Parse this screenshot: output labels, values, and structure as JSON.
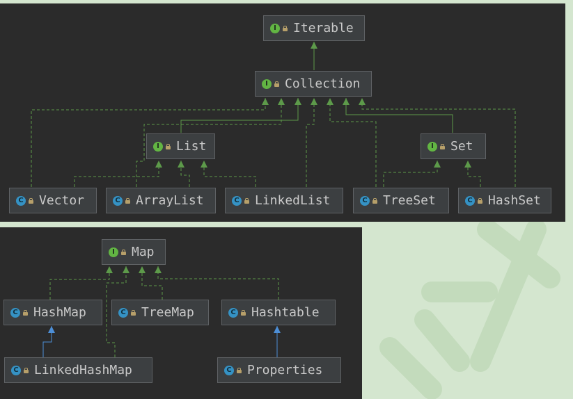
{
  "colors": {
    "panel_bg": "#2b2b2b",
    "node_bg": "#3c3f41",
    "interface_badge": "#62b543",
    "class_badge": "#3592c4",
    "implements_edge": "#5d9a4a",
    "extends_edge": "#4d8fd7"
  },
  "collection_diagram": {
    "nodes": {
      "iterable": {
        "label": "Iterable",
        "kind": "interface",
        "badge": "I"
      },
      "collection": {
        "label": "Collection",
        "kind": "interface",
        "badge": "I"
      },
      "list": {
        "label": "List",
        "kind": "interface",
        "badge": "I"
      },
      "set": {
        "label": "Set",
        "kind": "interface",
        "badge": "I"
      },
      "vector": {
        "label": "Vector",
        "kind": "class",
        "badge": "C"
      },
      "arraylist": {
        "label": "ArrayList",
        "kind": "class",
        "badge": "C"
      },
      "linkedlist": {
        "label": "LinkedList",
        "kind": "class",
        "badge": "C"
      },
      "treeset": {
        "label": "TreeSet",
        "kind": "class",
        "badge": "C"
      },
      "hashset": {
        "label": "HashSet",
        "kind": "class",
        "badge": "C"
      }
    },
    "edges": [
      {
        "from": "Collection",
        "to": "Iterable",
        "type": "extends-interface"
      },
      {
        "from": "List",
        "to": "Collection",
        "type": "extends-interface"
      },
      {
        "from": "Set",
        "to": "Collection",
        "type": "extends-interface"
      },
      {
        "from": "Vector",
        "to": "Collection",
        "type": "implements"
      },
      {
        "from": "Vector",
        "to": "List",
        "type": "implements"
      },
      {
        "from": "ArrayList",
        "to": "Collection",
        "type": "implements"
      },
      {
        "from": "ArrayList",
        "to": "List",
        "type": "implements"
      },
      {
        "from": "LinkedList",
        "to": "Collection",
        "type": "implements"
      },
      {
        "from": "LinkedList",
        "to": "List",
        "type": "implements"
      },
      {
        "from": "TreeSet",
        "to": "Collection",
        "type": "implements"
      },
      {
        "from": "TreeSet",
        "to": "Set",
        "type": "implements"
      },
      {
        "from": "HashSet",
        "to": "Collection",
        "type": "implements"
      },
      {
        "from": "HashSet",
        "to": "Set",
        "type": "implements"
      }
    ]
  },
  "map_diagram": {
    "nodes": {
      "map": {
        "label": "Map",
        "kind": "interface",
        "badge": "I"
      },
      "hashmap": {
        "label": "HashMap",
        "kind": "class",
        "badge": "C"
      },
      "treemap": {
        "label": "TreeMap",
        "kind": "class",
        "badge": "C"
      },
      "hashtable": {
        "label": "Hashtable",
        "kind": "class",
        "badge": "C"
      },
      "linkedhashmap": {
        "label": "LinkedHashMap",
        "kind": "class",
        "badge": "C"
      },
      "properties": {
        "label": "Properties",
        "kind": "class",
        "badge": "C"
      }
    },
    "edges": [
      {
        "from": "HashMap",
        "to": "Map",
        "type": "implements"
      },
      {
        "from": "TreeMap",
        "to": "Map",
        "type": "implements"
      },
      {
        "from": "Hashtable",
        "to": "Map",
        "type": "implements"
      },
      {
        "from": "LinkedHashMap",
        "to": "Map",
        "type": "implements"
      },
      {
        "from": "LinkedHashMap",
        "to": "HashMap",
        "type": "extends"
      },
      {
        "from": "Properties",
        "to": "Hashtable",
        "type": "extends"
      }
    ]
  }
}
